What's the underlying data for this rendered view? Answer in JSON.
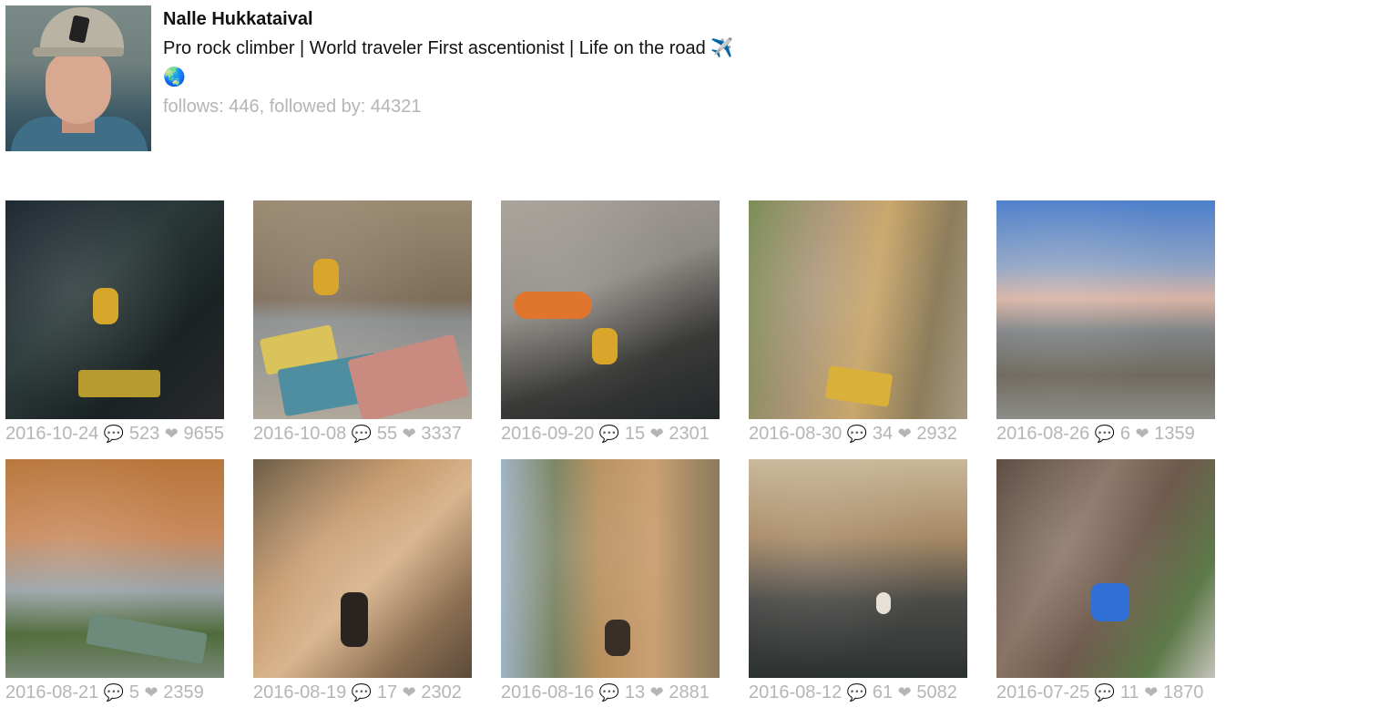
{
  "profile": {
    "name": "Nalle Hukkataival",
    "bio": "Pro rock climber | World traveler First ascentionist | Life on the road ✈️🌏",
    "stats": "follows: 446, followed by: 44321"
  },
  "icons": {
    "comment": "💬",
    "like": "❤"
  },
  "posts": [
    {
      "date": "2016-10-24",
      "comments": "523",
      "likes": "9655"
    },
    {
      "date": "2016-10-08",
      "comments": "55",
      "likes": "3337"
    },
    {
      "date": "2016-09-20",
      "comments": "15",
      "likes": "2301"
    },
    {
      "date": "2016-08-30",
      "comments": "34",
      "likes": "2932"
    },
    {
      "date": "2016-08-26",
      "comments": "6",
      "likes": "1359"
    },
    {
      "date": "2016-08-21",
      "comments": "5",
      "likes": "2359"
    },
    {
      "date": "2016-08-19",
      "comments": "17",
      "likes": "2302"
    },
    {
      "date": "2016-08-16",
      "comments": "13",
      "likes": "2881"
    },
    {
      "date": "2016-08-12",
      "comments": "61",
      "likes": "5082"
    },
    {
      "date": "2016-07-25",
      "comments": "11",
      "likes": "1870"
    }
  ]
}
